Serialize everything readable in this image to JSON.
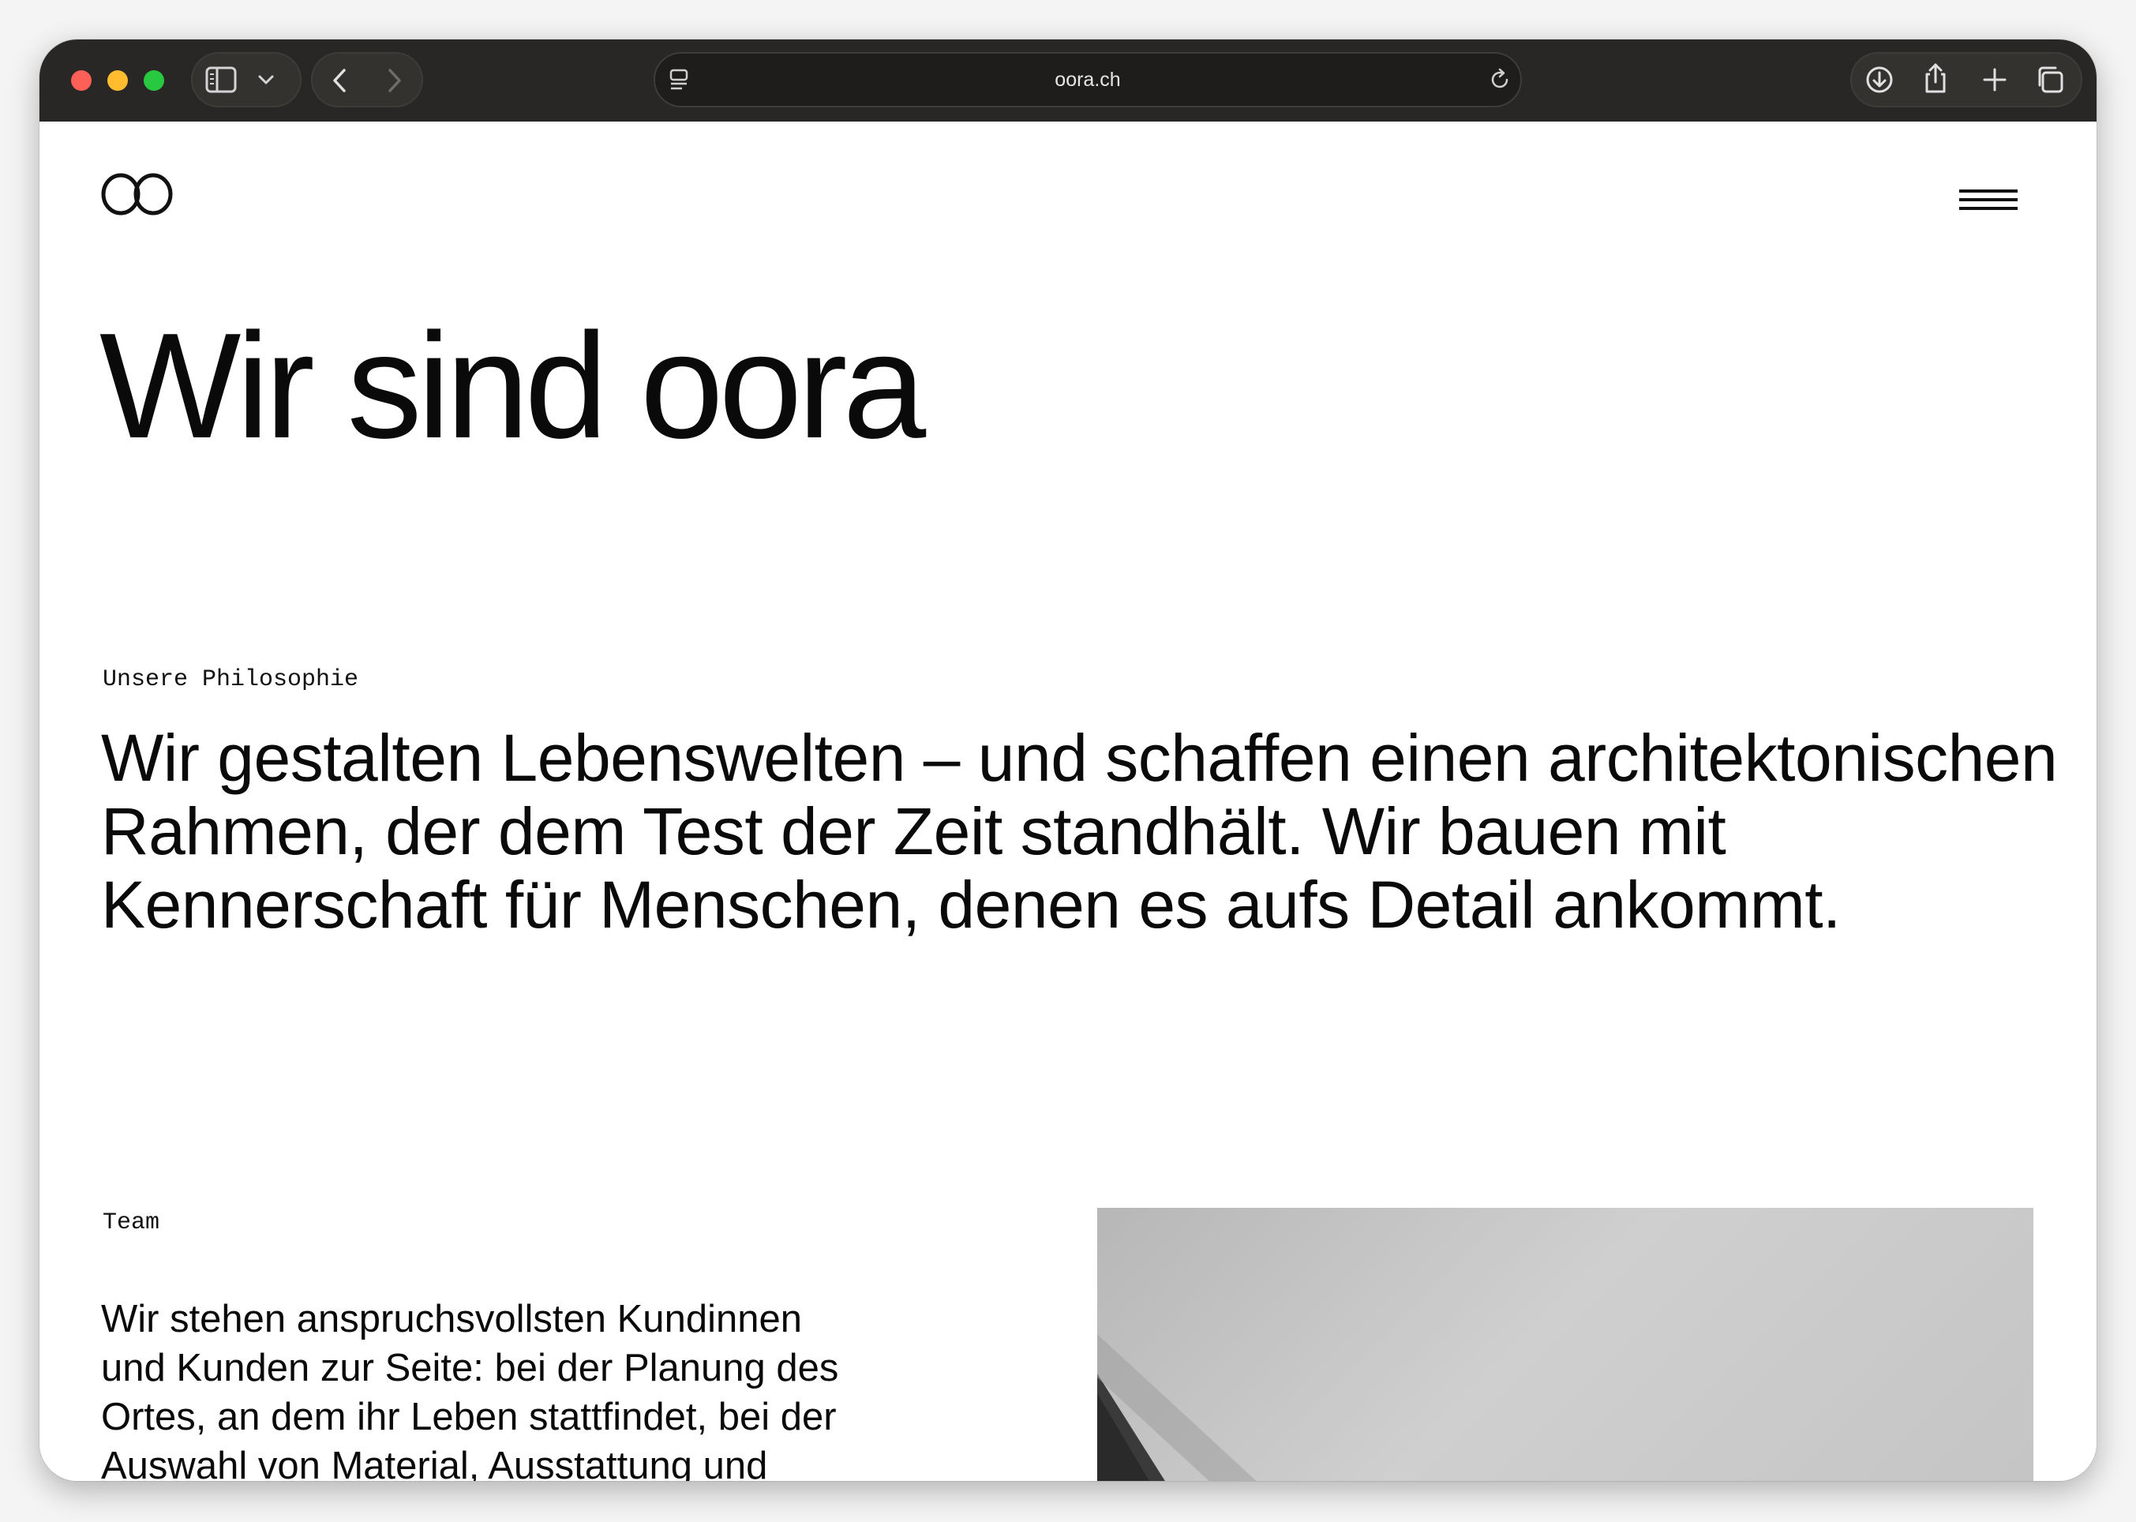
{
  "browser": {
    "url": "oora.ch",
    "colors": {
      "chrome": "#282725",
      "close": "#fe5f57",
      "minimize": "#febc2e",
      "zoom": "#28c840"
    },
    "icons": [
      "sidebar-icon",
      "chevron-down-icon",
      "back-arrow-icon",
      "forward-arrow-icon",
      "page-menu-icon",
      "reload-icon",
      "download-icon",
      "share-icon",
      "plus-icon",
      "tabs-overview-icon"
    ]
  },
  "site": {
    "logo_icon": "oora-logo",
    "menu_icon": "hamburger-menu-icon",
    "hero_title": "Wir sind oora",
    "philosophy": {
      "label": "Unsere Philosophie",
      "text": "Wir gestalten Lebenswelten – und schaffen einen architektonischen Rahmen, der dem Test der Zeit standhält. Wir bauen mit Kennerschaft für Menschen, denen es aufs Detail ankommt."
    },
    "team": {
      "label": "Team",
      "text": "Wir stehen anspruchsvollsten Kundinnen und Kunden zur Seite: bei der Planung des Ortes, an dem ihr Leben stattfindet, bei der Auswahl von Material, Ausstattung und"
    }
  }
}
